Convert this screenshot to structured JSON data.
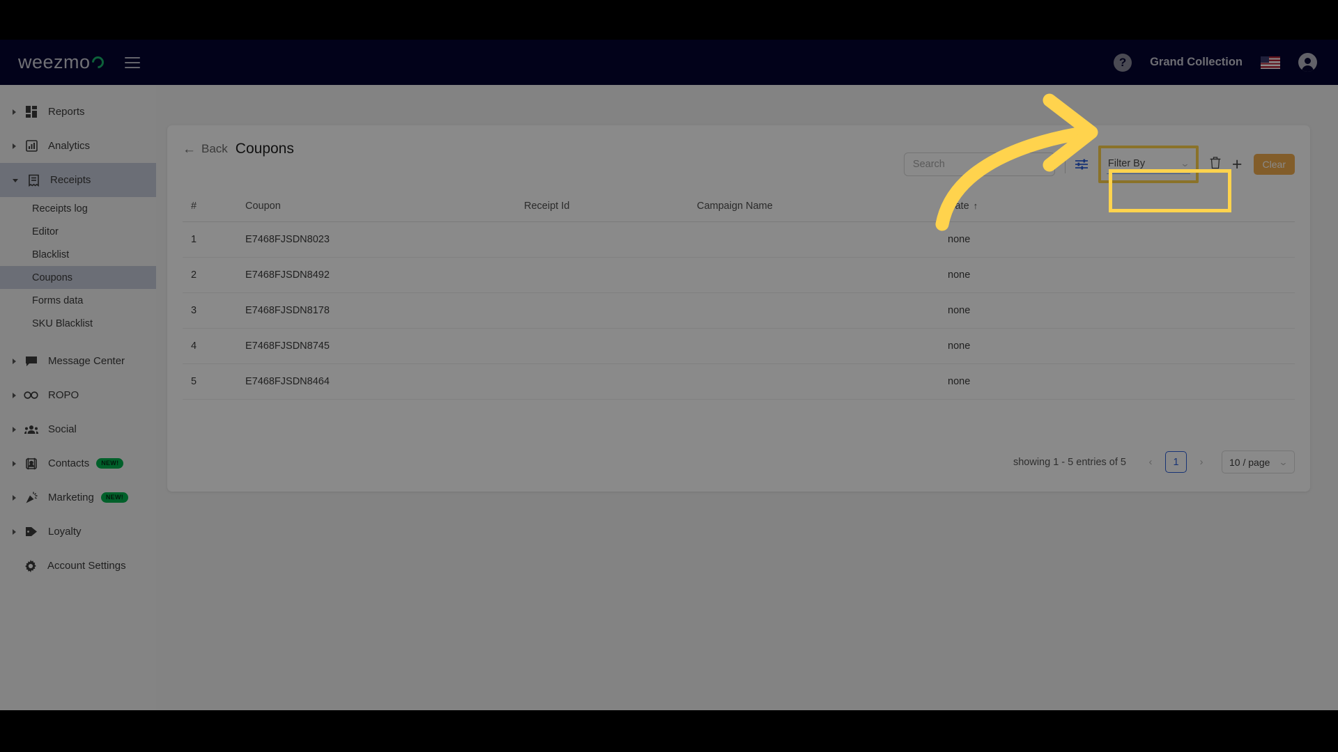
{
  "navbar": {
    "brand": "weezmo",
    "account_name": "Grand Collection",
    "help_icon": "question-mark-icon",
    "flag": "us-flag-icon",
    "avatar": "user-avatar-icon",
    "menu_icon": "hamburger-menu-icon",
    "bg_color": "#050531"
  },
  "sidebar": {
    "items": [
      {
        "label": "Reports",
        "icon": "dashboard-grid-icon",
        "expandable": true,
        "active": false
      },
      {
        "label": "Analytics",
        "icon": "bar-chart-icon",
        "expandable": true,
        "active": false
      },
      {
        "label": "Receipts",
        "icon": "receipt-icon",
        "expandable": true,
        "expanded": true,
        "active": true
      },
      {
        "label": "Message Center",
        "icon": "chat-bubble-icon",
        "expandable": true,
        "active": false
      },
      {
        "label": "ROPO",
        "icon": "infinity-icon",
        "expandable": true,
        "active": false
      },
      {
        "label": "Social",
        "icon": "people-group-icon",
        "expandable": true,
        "active": false
      },
      {
        "label": "Contacts",
        "icon": "contact-card-icon",
        "expandable": true,
        "active": false,
        "badge": "NEW!"
      },
      {
        "label": "Marketing",
        "icon": "party-popper-icon",
        "expandable": true,
        "active": false,
        "badge": "NEW!"
      },
      {
        "label": "Loyalty",
        "icon": "tag-icon",
        "expandable": true,
        "active": false
      },
      {
        "label": "Account Settings",
        "icon": "gear-icon",
        "expandable": false,
        "active": false
      }
    ],
    "receipts_subitems": [
      {
        "label": "Receipts log",
        "active": false
      },
      {
        "label": "Editor",
        "active": false
      },
      {
        "label": "Blacklist",
        "active": false
      },
      {
        "label": "Coupons",
        "active": true
      },
      {
        "label": "Forms data",
        "active": false
      },
      {
        "label": "SKU Blacklist",
        "active": false
      }
    ],
    "badge_color": "#00b14f",
    "active_color": "#c6cbdb"
  },
  "page": {
    "back_label": "Back",
    "title": "Coupons"
  },
  "toolbar": {
    "search_placeholder": "Search",
    "search_value": "",
    "sliders_icon": "filter-sliders-icon",
    "filter_label": "Filter By",
    "filter_chevron": "chevron-down-icon",
    "trash_icon": "trash-icon",
    "plus_icon": "plus-icon",
    "clear_label": "Clear",
    "clear_color": "#f0ad4e"
  },
  "table": {
    "columns": [
      "#",
      "Coupon",
      "Receipt Id",
      "Campaign Name",
      "Date"
    ],
    "sort_column": "Date",
    "sort_arrow": "↑",
    "rows": [
      {
        "idx": "1",
        "coupon": "E7468FJSDN8023",
        "receipt_id": "",
        "campaign_name": "",
        "date": "none"
      },
      {
        "idx": "2",
        "coupon": "E7468FJSDN8492",
        "receipt_id": "",
        "campaign_name": "",
        "date": "none"
      },
      {
        "idx": "3",
        "coupon": "E7468FJSDN8178",
        "receipt_id": "",
        "campaign_name": "",
        "date": "none"
      },
      {
        "idx": "4",
        "coupon": "E7468FJSDN8745",
        "receipt_id": "",
        "campaign_name": "",
        "date": "none"
      },
      {
        "idx": "5",
        "coupon": "E7468FJSDN8464",
        "receipt_id": "",
        "campaign_name": "",
        "date": "none"
      }
    ]
  },
  "pagination": {
    "showing_text": "showing 1 - 5 entries of 5",
    "prev_icon": "chevron-left-icon",
    "next_icon": "chevron-right-icon",
    "current_page": "1",
    "per_page_label": "10 / page",
    "per_page_chevron": "chevron-down-icon"
  },
  "annotation": {
    "arrow_color": "#ffd34d",
    "highlight_border_color": "#ffd34d",
    "highlight_target": "filter-by-dropdown",
    "arrow_icon": "curved-arrow-right-icon"
  }
}
